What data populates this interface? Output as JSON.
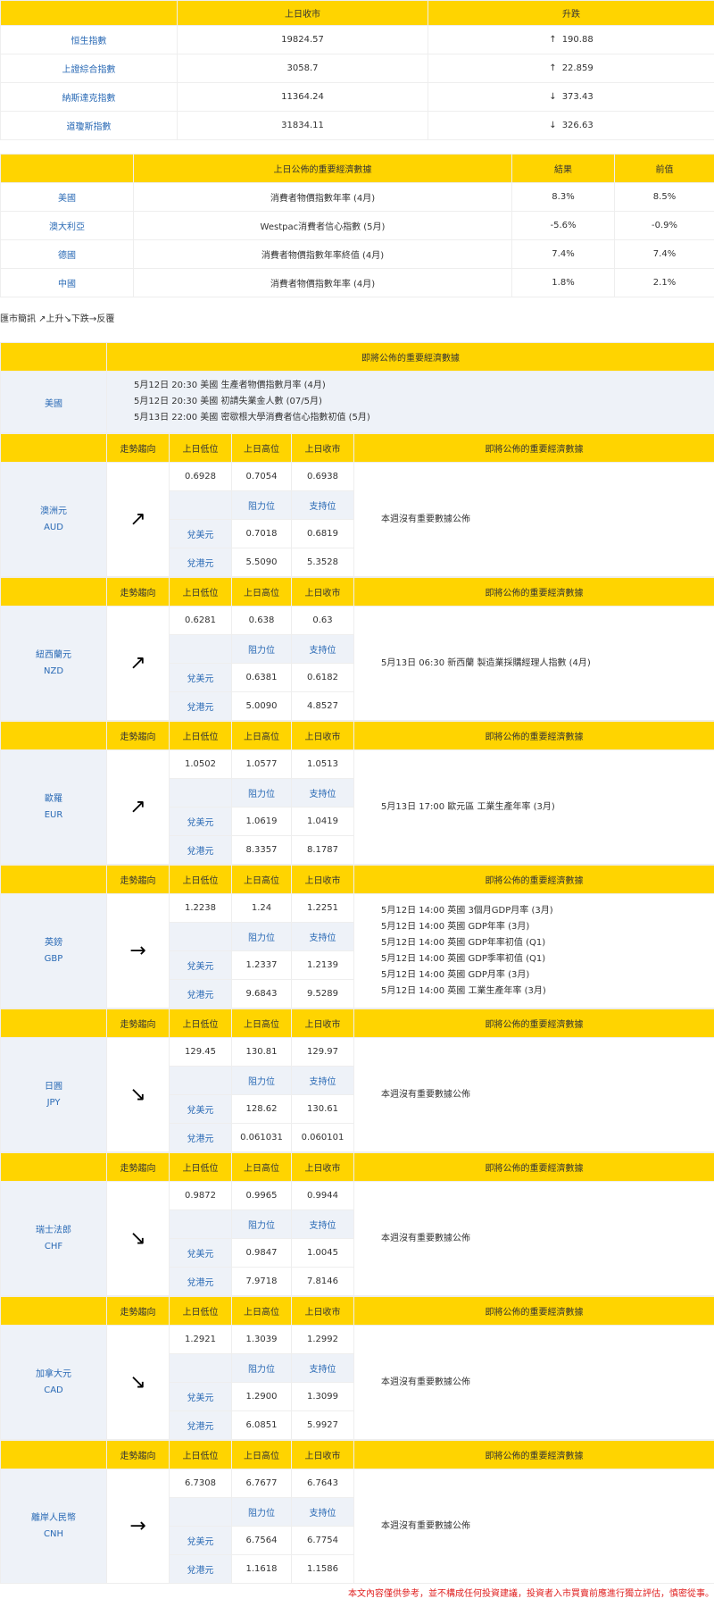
{
  "indices": {
    "headers": [
      "",
      "上日收市",
      "升跌"
    ],
    "rows": [
      {
        "name": "恒生指數",
        "close": "19824.57",
        "arrow": "↑",
        "change": "190.88"
      },
      {
        "name": "上證綜合指數",
        "close": "3058.7",
        "arrow": "↑",
        "change": "22.859"
      },
      {
        "name": "納斯達克指數",
        "close": "11364.24",
        "arrow": "↓",
        "change": "373.43"
      },
      {
        "name": "道瓊斯指數",
        "close": "31834.11",
        "arrow": "↓",
        "change": "326.63"
      }
    ]
  },
  "econ_released": {
    "headers": [
      "",
      "上日公佈的重要經濟數據",
      "結果",
      "前值"
    ],
    "rows": [
      {
        "country": "美國",
        "item": "消費者物價指數年率 (4月)",
        "result": "8.3%",
        "prev": "8.5%"
      },
      {
        "country": "澳大利亞",
        "item": "Westpac消費者信心指數 (5月)",
        "result": "-5.6%",
        "prev": "-0.9%"
      },
      {
        "country": "德國",
        "item": "消費者物價指數年率終值 (4月)",
        "result": "7.4%",
        "prev": "7.4%"
      },
      {
        "country": "中國",
        "item": "消費者物價指數年率 (4月)",
        "result": "1.8%",
        "prev": "2.1%"
      }
    ]
  },
  "legend": "匯市簡訊 ↗上升↘下跌→反覆",
  "upcoming": {
    "header": "即將公佈的重要經濟數據",
    "country": "美國",
    "lines": [
      "5月12日 20:30  美國 生產者物價指數月率 (4月)",
      "5月12日 20:30  美國 初請失業金人數 (07/5月)",
      "5月13日 22:00  美國 密歇根大學消費者信心指數初值 (5月)"
    ]
  },
  "currency_headers": {
    "trend": "走勢趨向",
    "low": "上日低位",
    "high": "上日高位",
    "close": "上日收市",
    "news": "即將公佈的重要經濟數據",
    "resistance": "阻力位",
    "support": "支持位",
    "vs_usd": "兌美元",
    "vs_hkd": "兌港元"
  },
  "currencies": [
    {
      "name": "澳洲元",
      "code": "AUD",
      "trend": "↗",
      "low": "0.6928",
      "high": "0.7054",
      "close": "0.6938",
      "usd_res": "0.7018",
      "usd_sup": "0.6819",
      "hkd_res": "5.5090",
      "hkd_sup": "5.3528",
      "news": [
        "本週沒有重要數據公佈"
      ]
    },
    {
      "name": "紐西蘭元",
      "code": "NZD",
      "trend": "↗",
      "low": "0.6281",
      "high": "0.638",
      "close": "0.63",
      "usd_res": "0.6381",
      "usd_sup": "0.6182",
      "hkd_res": "5.0090",
      "hkd_sup": "4.8527",
      "news": [
        "5月13日 06:30  新西蘭 製造業採購經理人指數 (4月)"
      ]
    },
    {
      "name": "歐羅",
      "code": "EUR",
      "trend": "↗",
      "low": "1.0502",
      "high": "1.0577",
      "close": "1.0513",
      "usd_res": "1.0619",
      "usd_sup": "1.0419",
      "hkd_res": "8.3357",
      "hkd_sup": "8.1787",
      "news": [
        "5月13日 17:00  歐元區 工業生產年率 (3月)"
      ]
    },
    {
      "name": "英鎊",
      "code": "GBP",
      "trend": "→",
      "low": "1.2238",
      "high": "1.24",
      "close": "1.2251",
      "usd_res": "1.2337",
      "usd_sup": "1.2139",
      "hkd_res": "9.6843",
      "hkd_sup": "9.5289",
      "news": [
        "5月12日 14:00  英國 3個月GDP月率 (3月)",
        "5月12日 14:00  英國 GDP年率 (3月)",
        "5月12日 14:00  英國 GDP年率初值 (Q1)",
        "5月12日 14:00  英國 GDP季率初值 (Q1)",
        "5月12日 14:00  英國 GDP月率 (3月)",
        "5月12日 14:00  英國 工業生產年率 (3月)"
      ]
    },
    {
      "name": "日圓",
      "code": "JPY",
      "trend": "↘",
      "low": "129.45",
      "high": "130.81",
      "close": "129.97",
      "usd_res": "128.62",
      "usd_sup": "130.61",
      "hkd_res": "0.061031",
      "hkd_sup": "0.060101",
      "news": [
        "本週沒有重要數據公佈"
      ]
    },
    {
      "name": "瑞士法郎",
      "code": "CHF",
      "trend": "↘",
      "low": "0.9872",
      "high": "0.9965",
      "close": "0.9944",
      "usd_res": "0.9847",
      "usd_sup": "1.0045",
      "hkd_res": "7.9718",
      "hkd_sup": "7.8146",
      "news": [
        "本週沒有重要數據公佈"
      ]
    },
    {
      "name": "加拿大元",
      "code": "CAD",
      "trend": "↘",
      "low": "1.2921",
      "high": "1.3039",
      "close": "1.2992",
      "usd_res": "1.2900",
      "usd_sup": "1.3099",
      "hkd_res": "6.0851",
      "hkd_sup": "5.9927",
      "news": [
        "本週沒有重要數據公佈"
      ]
    },
    {
      "name": "離岸人民幣",
      "code": "CNH",
      "trend": "→",
      "low": "6.7308",
      "high": "6.7677",
      "close": "6.7643",
      "usd_res": "6.7564",
      "usd_sup": "6.7754",
      "hkd_res": "1.1618",
      "hkd_sup": "1.1586",
      "news": [
        "本週沒有重要數據公佈"
      ]
    }
  ],
  "footer": "本文內容僅供參考，並不構成任何投資建議，投資者入市買賣前應進行獨立評估，慎密從事。"
}
